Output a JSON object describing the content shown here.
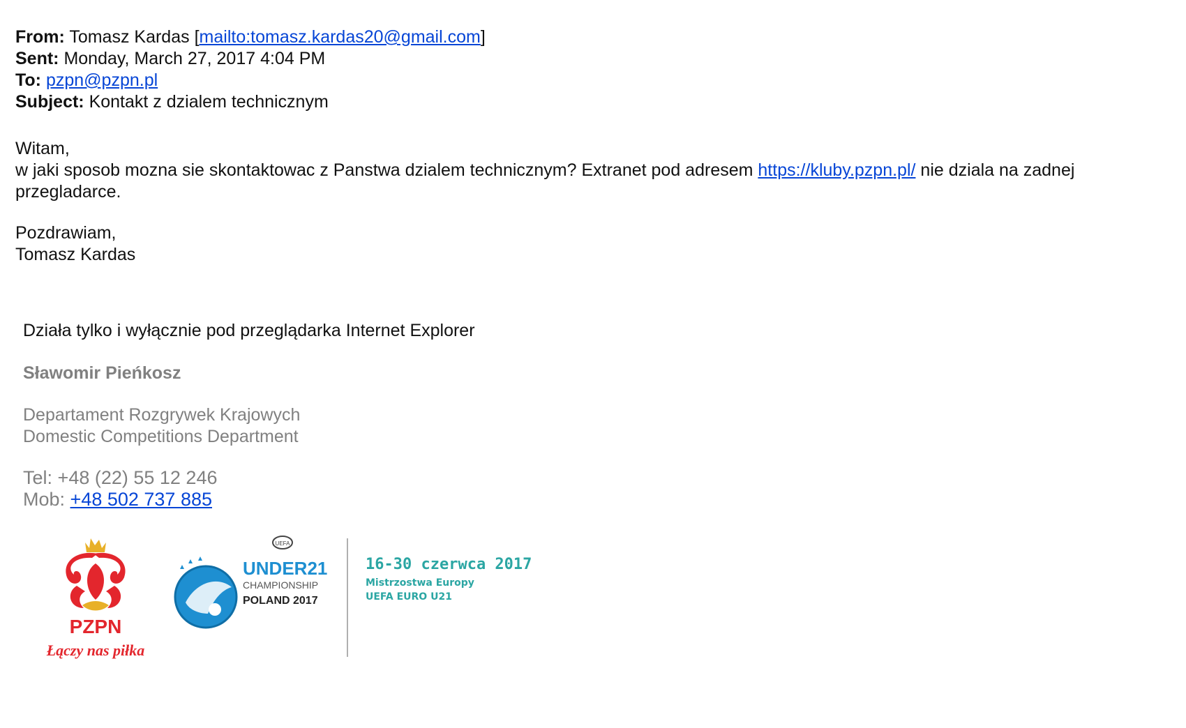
{
  "email": {
    "from_label": "From:",
    "from_name": "Tomasz Kardas",
    "from_link": "mailto:tomasz.kardas20@gmail.com",
    "sent_label": "Sent:",
    "sent_value": "Monday, March 27, 2017 4:04 PM",
    "to_label": "To:",
    "to_value": "pzpn@pzpn.pl",
    "subject_label": "Subject:",
    "subject_value": "Kontakt z dzialem technicznym"
  },
  "body": {
    "greeting": "Witam,",
    "line1_before_link": "w jaki sposob mozna sie skontaktowac z Panstwa dzialem technicznym? Extranet pod adresem",
    "link": "https://kluby.pzpn.pl/",
    "line1_after_link": "nie dziala na zadnej",
    "line2": "przegladarce.",
    "closing": "Pozdrawiam,",
    "signature": "Tomasz Kardas"
  },
  "reply": {
    "text": "Działa tylko i wyłącznie pod przeglądarka Internet Explorer",
    "name": "Sławomir Pieńkosz",
    "dept_pl": "Departament Rozgrywek Krajowych",
    "dept_en": "Domestic Competitions Department",
    "tel_label": "Tel:",
    "tel_value": "+48 (22) 55 12 246",
    "mob_label": "Mob:",
    "mob_value": "+48 502 737 885"
  },
  "logos": {
    "pzpn_name": "PZPN",
    "pzpn_slogan": "Łączy nas piłka",
    "uefa_small": "UEFA",
    "u21_title": "UNDER21",
    "u21_champ": "CHAMPIONSHIP",
    "u21_poland": "POLAND 2017",
    "dates": "16-30 czerwca 2017",
    "euro_pl": "Mistrzostwa Europy",
    "euro_short": "UEFA EURO U21"
  },
  "colors": {
    "link": "#0645d6",
    "signature_gray": "#808080",
    "pzpn_red": "#e3262d",
    "uefa_blue": "#1e8fd1",
    "teal": "#2ba6a3"
  }
}
